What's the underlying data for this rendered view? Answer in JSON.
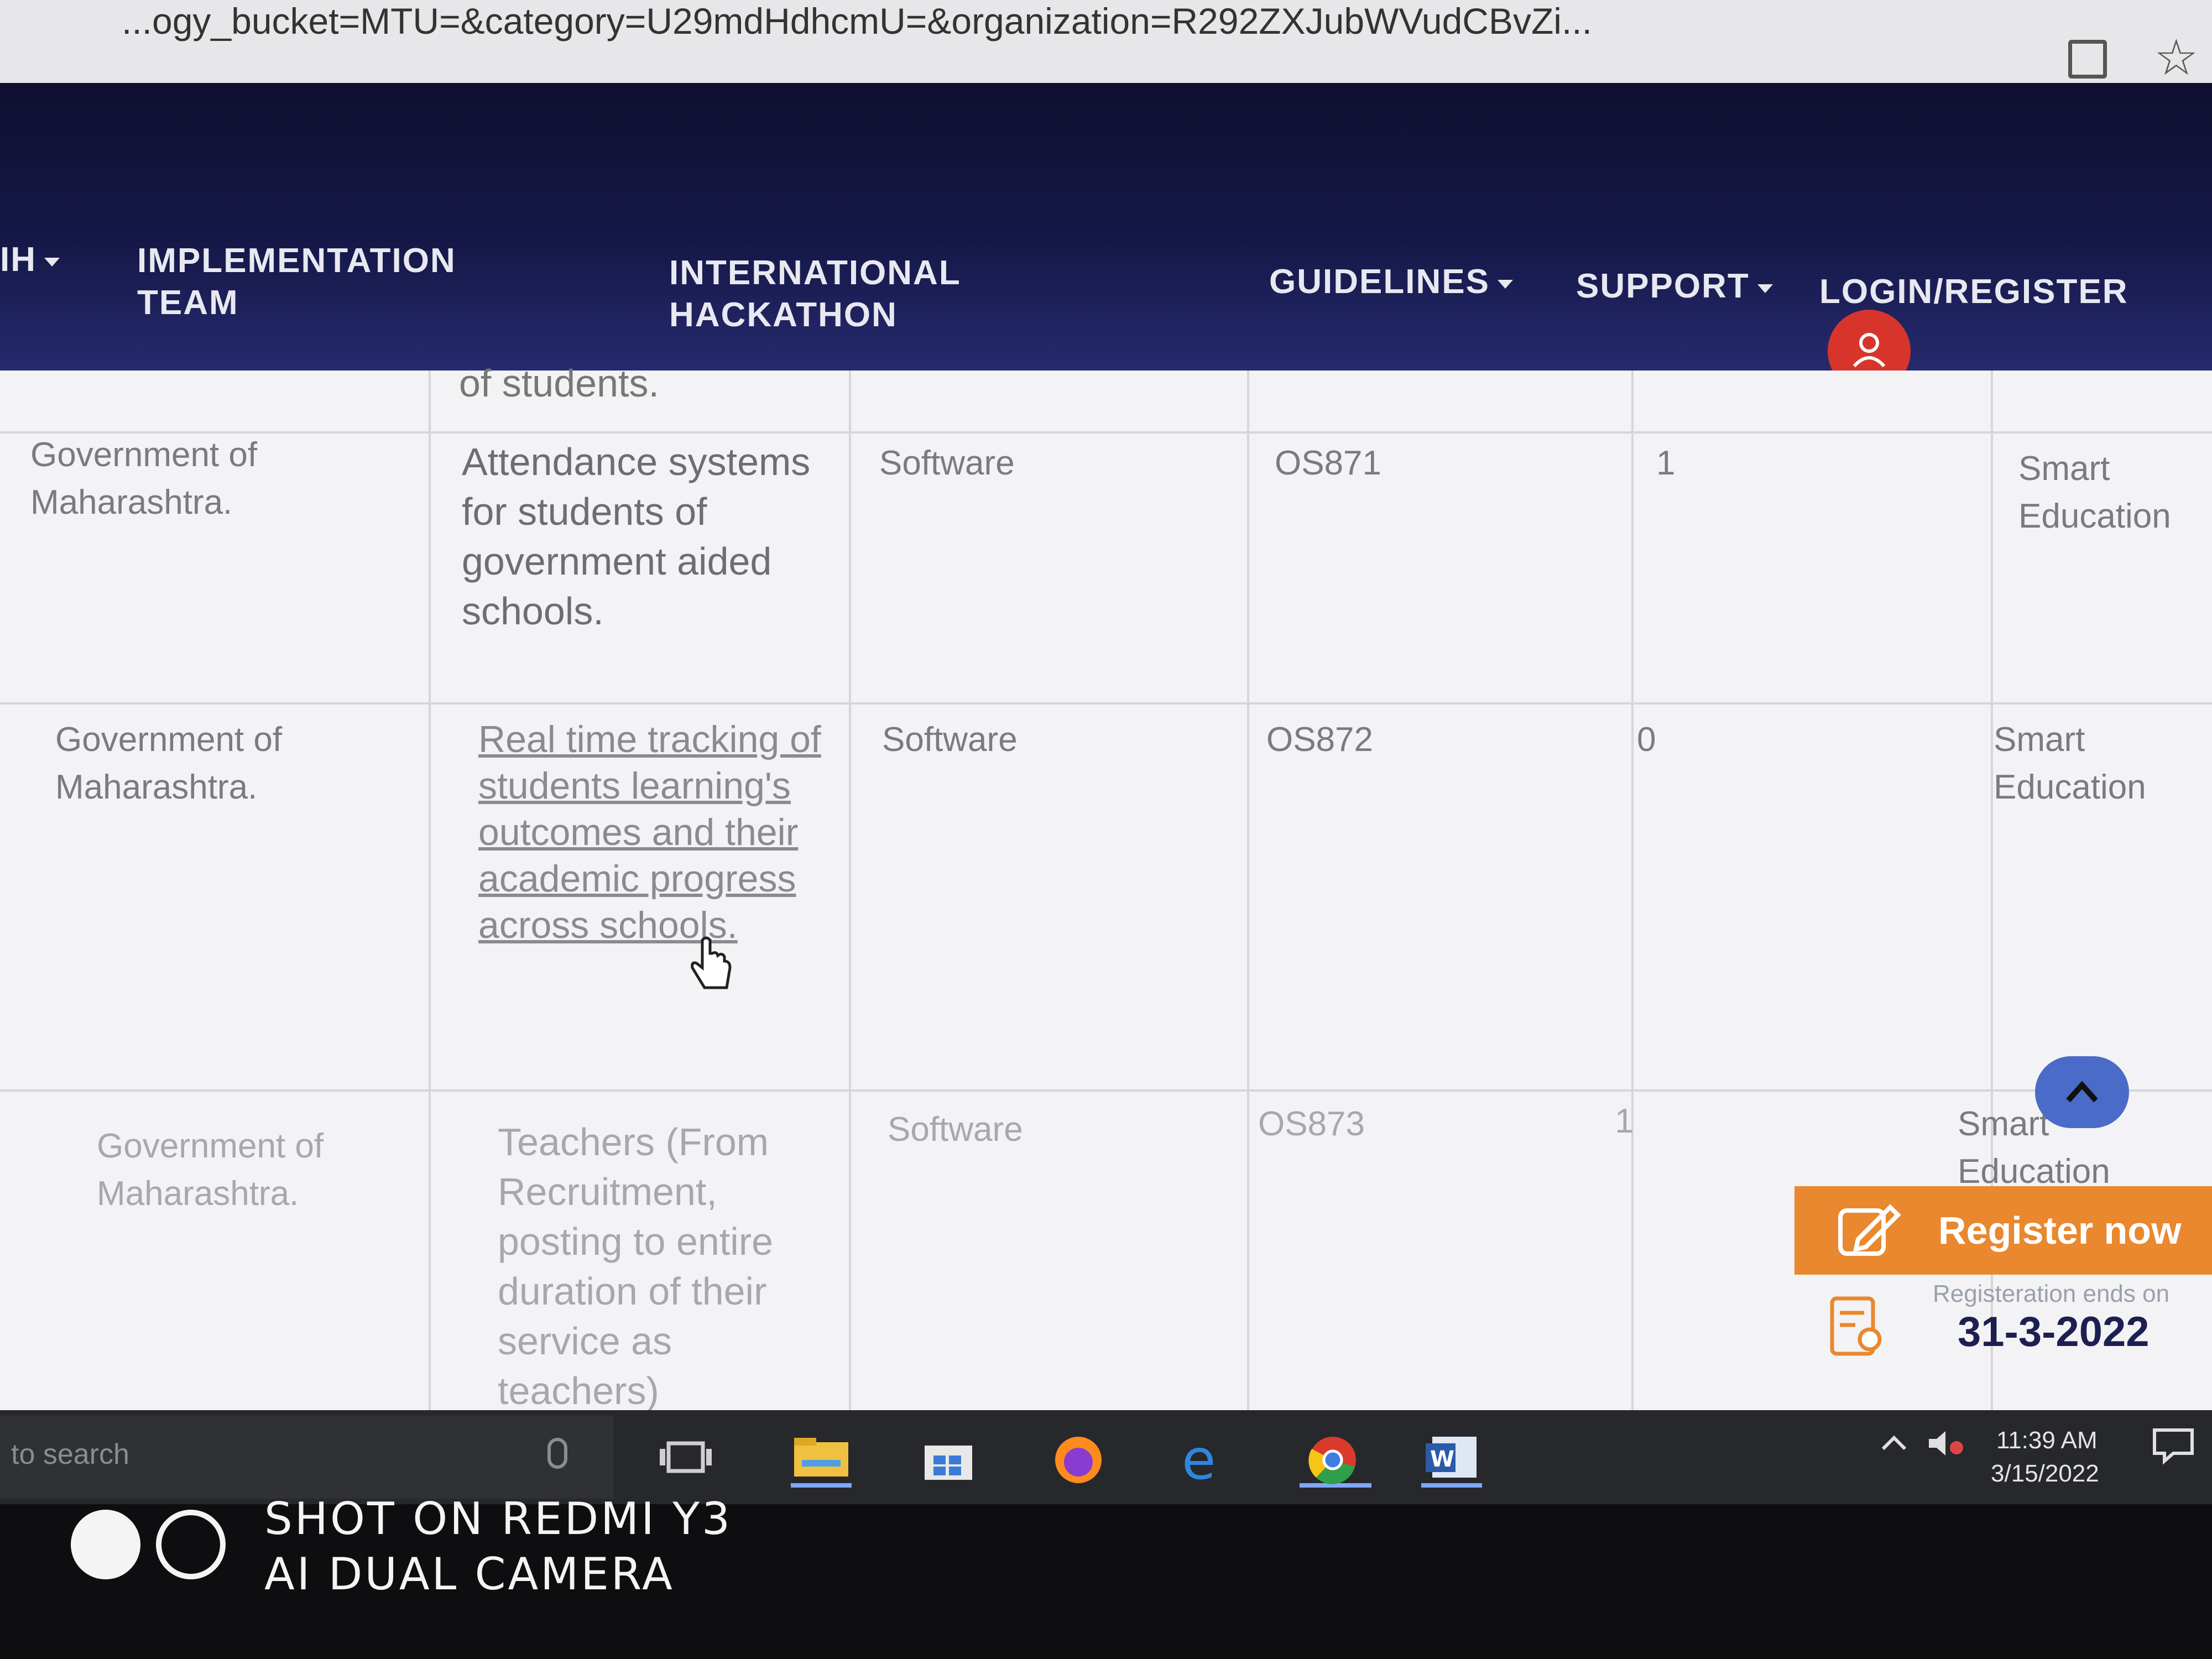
{
  "browser": {
    "url": "...ogy_bucket=MTU=&category=U29mdHdhcmU=&organization=R292ZXJubWVudCBvZi..."
  },
  "nav": {
    "sih": "IH",
    "implementation": "IMPLEMENTATION TEAM",
    "international": "INTERNATIONAL HACKATHON",
    "guidelines": "GUIDELINES",
    "support": "SUPPORT",
    "login": "LOGIN/REGISTER"
  },
  "table": {
    "cutoff_text": "of students.",
    "rows": [
      {
        "organization": "Government of Maharashtra.",
        "title": "Attendance systems for students of government aided schools.",
        "category": "Software",
        "ps_number": "OS871",
        "submissions": "1",
        "domain": "Smart Education"
      },
      {
        "organization": "Government of Maharashtra.",
        "title": "Real time tracking of students learning's outcomes and their academic progress across schools.",
        "category": "Software",
        "ps_number": "OS872",
        "submissions": "0",
        "domain": "Smart Education"
      },
      {
        "organization": "Government of Maharashtra.",
        "title": "Teachers (From Recruitment, posting to entire duration of their service as teachers) Management",
        "category": "Software",
        "ps_number": "OS873",
        "submissions": "1",
        "domain": "Smart Education"
      }
    ]
  },
  "widgets": {
    "register_label": "Register now",
    "registration_ends_label": "Registeration ends on",
    "registration_end_date": "31-3-2022"
  },
  "taskbar": {
    "search_placeholder": "to search",
    "time": "11:39 AM",
    "date": "3/15/2022"
  },
  "watermark": {
    "line1": "SHOT ON REDMI Y3",
    "line2": "AI DUAL CAMERA"
  }
}
